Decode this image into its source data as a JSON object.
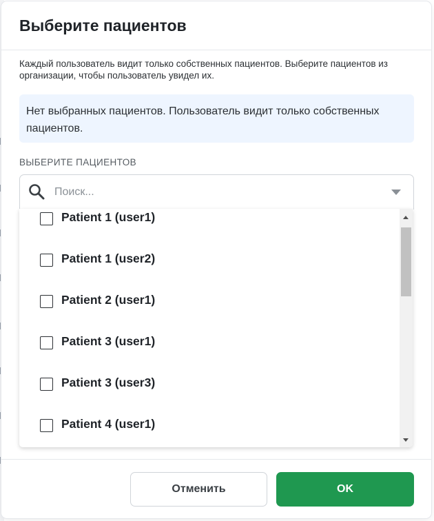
{
  "dialog": {
    "title": "Выберите пациентов",
    "description": "Каждый пользователь видит только собственных пациентов. Выберите пациентов из организации, чтобы пользователь увидел их.",
    "info_message": "Нет выбранных пациентов. Пользователь видит только собственных пациентов."
  },
  "select": {
    "label": "ВЫБЕРИТЕ ПАЦИЕНТОВ",
    "placeholder": "Поиск...",
    "value": "",
    "options": [
      {
        "label": "Patient 1 (user1)",
        "checked": false
      },
      {
        "label": "Patient 1 (user2)",
        "checked": false
      },
      {
        "label": "Patient 2 (user1)",
        "checked": false
      },
      {
        "label": "Patient 3 (user1)",
        "checked": false
      },
      {
        "label": "Patient 3 (user3)",
        "checked": false
      },
      {
        "label": "Patient 4 (user1)",
        "checked": false
      }
    ]
  },
  "footer": {
    "cancel_label": "Отменить",
    "ok_label": "OK"
  },
  "colors": {
    "accent": "#1f9850",
    "info_background": "#eef5ff",
    "text": "#1f2328"
  },
  "icons": [
    "search-icon",
    "chevron-down-icon",
    "checkbox-icon",
    "scroll-up-arrow-icon",
    "scroll-down-arrow-icon"
  ]
}
